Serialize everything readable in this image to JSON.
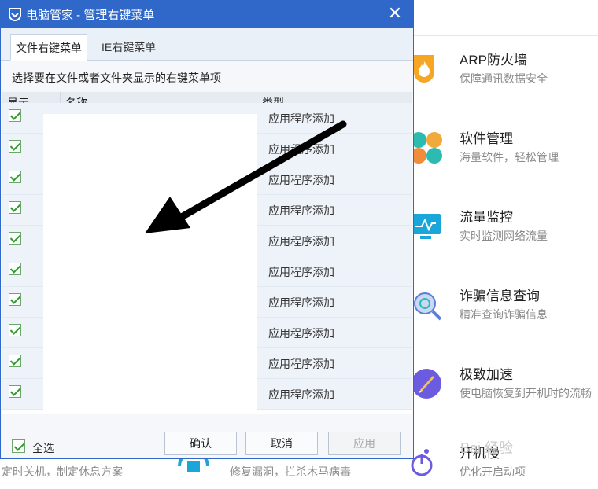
{
  "dialog": {
    "title": "电脑管家 - 管理右键菜单",
    "tabs": [
      {
        "label": "文件右键菜单",
        "active": true
      },
      {
        "label": "IE右键菜单",
        "active": false
      }
    ],
    "instruction": "选择要在文件或者文件夹显示的右键菜单项",
    "table": {
      "columns": [
        "显示",
        "名称",
        "类型"
      ],
      "rows": [
        {
          "checked": true,
          "name": "",
          "type": "应用程序添加"
        },
        {
          "checked": true,
          "name": "",
          "type": "应用程序添加"
        },
        {
          "checked": true,
          "name": "",
          "type": "应用程序添加"
        },
        {
          "checked": true,
          "name": "",
          "type": "应用程序添加"
        },
        {
          "checked": true,
          "name": "",
          "type": "应用程序添加"
        },
        {
          "checked": true,
          "name": "",
          "type": "应用程序添加"
        },
        {
          "checked": true,
          "name": "",
          "type": "应用程序添加"
        },
        {
          "checked": true,
          "name": "",
          "type": "应用程序添加"
        },
        {
          "checked": true,
          "name": "",
          "type": "应用程序添加"
        },
        {
          "checked": true,
          "name": "",
          "type": "应用程序添加"
        }
      ]
    },
    "footer": {
      "select_all_label": "全选",
      "select_all_checked": true,
      "confirm_label": "确认",
      "cancel_label": "取消",
      "apply_label": "应用"
    }
  },
  "background": {
    "tools": [
      {
        "name": "ARP防火墙",
        "desc": "保障通讯数据安全",
        "icon": "shield-flame-icon"
      },
      {
        "name": "软件管理",
        "desc": "海量软件，轻松管理",
        "icon": "clover-icon"
      },
      {
        "name": "流量监控",
        "desc": "实时监测网络流量",
        "icon": "monitor-chart-icon"
      },
      {
        "name": "诈骗信息查询",
        "desc": "精准查询诈骗信息",
        "icon": "magnifier-globe-icon"
      },
      {
        "name": "极致加速",
        "desc": "使电脑恢复到开机时的流畅",
        "icon": "rocket-icon"
      },
      {
        "name": "开机慢",
        "desc": "优化开启动项",
        "icon": "power-icon"
      }
    ],
    "bottom_descs": [
      "定时关机，制定休息方案",
      "修复漏洞，拦杀木马病毒"
    ],
    "watermark": "Bai 经验"
  },
  "colors": {
    "titlebar": "#2f68c9",
    "row_bg": "#eef3f9",
    "checkbox_green": "#2e9a2e",
    "arrow": "#000000"
  }
}
